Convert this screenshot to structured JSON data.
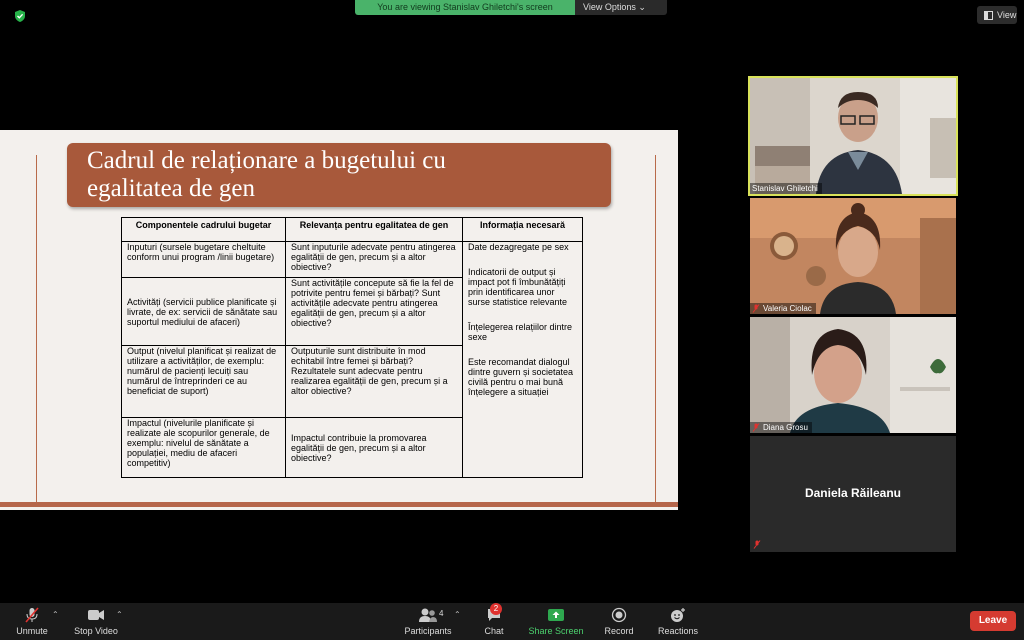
{
  "banner": {
    "text": "You are viewing Stanislav Ghiletchi's screen",
    "options_label": "View Options"
  },
  "view_button": {
    "label": "View"
  },
  "slide": {
    "title_line1": "Cadrul de relaționare a bugetului cu",
    "title_line2": "egalitatea de gen",
    "table": {
      "headers": [
        "Componentele cadrului bugetar",
        "Relevanța pentru egalitatea de gen",
        "Informația necesară"
      ],
      "rows": [
        [
          "Inputuri (sursele bugetare cheltuite conform unui program /linii bugetare)",
          "Sunt inputurile adecvate pentru atingerea egalității de gen, precum și a altor obiective?"
        ],
        [
          "Activități (servicii publice planificate și livrate, de ex: servicii de sănătate sau suportul mediului de afaceri)",
          "Sunt activitățile concepute să fie la fel de potrivite pentru femei și bărbați? Sunt activitățile adecvate pentru atingerea egalității de gen, precum și a altor obiective?"
        ],
        [
          "Output (nivelul planificat și realizat de utilizare a activităților, de exemplu: numărul de pacienți lecuiți sau numărul de întreprinderi ce au beneficiat de suport)",
          "Outputurile sunt distribuite în mod echitabil între femei și bărbați? Rezultatele sunt adecvate pentru realizarea egalității de gen, precum și a altor obiective?"
        ],
        [
          "Impactul (nivelurile planificate și realizate ale scopurilor generale, de exemplu: nivelul de sănătate a populației, mediu de afaceri competitiv)",
          "Impactul contribuie la promovarea egalității de gen, precum și a altor obiective?"
        ]
      ],
      "info": [
        "Date dezagregate pe sex",
        "Indicatorii de output și impact pot fi îmbunătățiți prin identificarea unor surse statistice relevante",
        "Înțelegerea relațiilor dintre sexe",
        "Este recomandat dialogul dintre guvern și societatea civilă pentru o mai bună înțelegere a situației"
      ]
    }
  },
  "participants_panel": [
    {
      "name": "Stanislav Ghiletchi",
      "muted": false
    },
    {
      "name": "Valeria Ciolac",
      "muted": true
    },
    {
      "name": "Diana Grosu",
      "muted": true
    },
    {
      "name": "Daniela Răileanu",
      "muted": true,
      "video_off": true
    }
  ],
  "toolbar": {
    "unmute": "Unmute",
    "stop_video": "Stop Video",
    "participants": "Participants",
    "participants_count": "4",
    "chat": "Chat",
    "chat_badge": "2",
    "share_screen": "Share Screen",
    "record": "Record",
    "reactions": "Reactions",
    "leave": "Leave"
  },
  "colors": {
    "share_green": "#4ab36a",
    "leave_red": "#d53b31",
    "slide_accent": "#a8593b",
    "active_speaker_border": "#d9e25a"
  }
}
